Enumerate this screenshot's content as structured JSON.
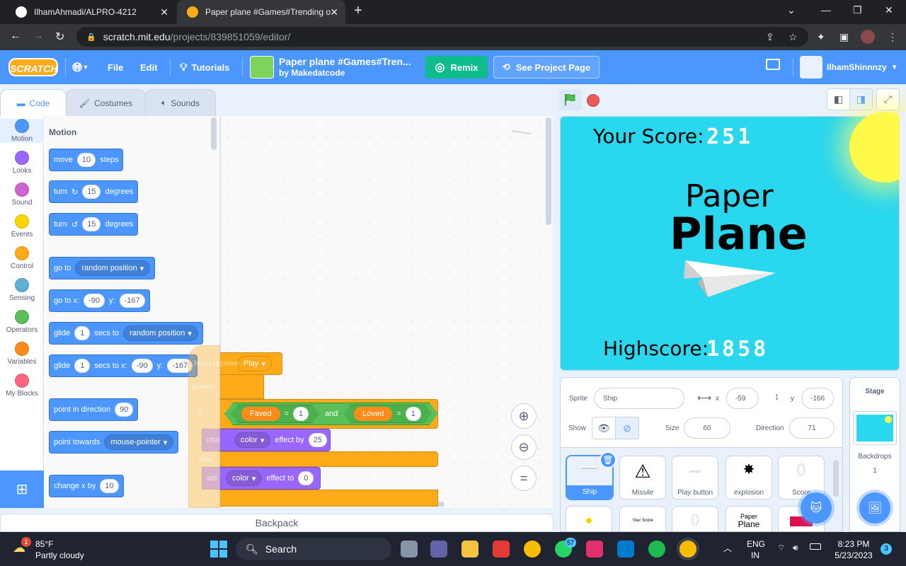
{
  "browser": {
    "tabs": [
      {
        "title": "IlhamAhmadi/ALPRO-4212"
      },
      {
        "title": "Paper plane #Games#Trending o"
      }
    ],
    "url_host": "scratch.mit.edu",
    "url_path": "/projects/839851059/editor/"
  },
  "menubar": {
    "logo": "SCRATCH",
    "file": "File",
    "edit": "Edit",
    "tutorials": "Tutorials",
    "project_title": "Paper plane #Games#Tren...",
    "project_author": "by Makedatcode",
    "remix": "Remix",
    "see_project_page": "See Project Page",
    "username": "IlhamShinnnzy"
  },
  "editor_tabs": {
    "code": "Code",
    "costumes": "Costumes",
    "sounds": "Sounds"
  },
  "categories": [
    {
      "label": "Motion",
      "color": "#4c97ff"
    },
    {
      "label": "Looks",
      "color": "#9966ff"
    },
    {
      "label": "Sound",
      "color": "#cf63cf"
    },
    {
      "label": "Events",
      "color": "#ffd500"
    },
    {
      "label": "Control",
      "color": "#ffab19"
    },
    {
      "label": "Sensing",
      "color": "#5cb1d6"
    },
    {
      "label": "Operators",
      "color": "#59c059"
    },
    {
      "label": "Variables",
      "color": "#ff8c1a"
    },
    {
      "label": "My Blocks",
      "color": "#ff6680"
    }
  ],
  "palette": {
    "heading": "Motion",
    "move": {
      "a": "move",
      "n": "10",
      "b": "steps"
    },
    "turn_right": {
      "a": "turn",
      "n": "15",
      "b": "degrees"
    },
    "turn_left": {
      "a": "turn",
      "n": "15",
      "b": "degrees"
    },
    "goto": {
      "a": "go to",
      "opt": "random position"
    },
    "gotoxy": {
      "a": "go to x:",
      "x": "-90",
      "b": "y:",
      "y": "-167"
    },
    "glide": {
      "a": "glide",
      "n": "1",
      "b": "secs to",
      "opt": "random position"
    },
    "glidexy": {
      "a": "glide",
      "n": "1",
      "b": "secs to x:",
      "x": "-90",
      "c": "y:",
      "y": "-167"
    },
    "point_dir": {
      "a": "point in direction",
      "n": "90"
    },
    "point_towards": {
      "a": "point towards",
      "opt": "mouse-pointer"
    },
    "change_x": {
      "a": "change x by",
      "n": "10"
    }
  },
  "script": {
    "receive": "hen I receive",
    "receive_opt": "Play",
    "forever": "forever",
    "if": "if",
    "faved": "Faved",
    "eq": "=",
    "one": "1",
    "and": "and",
    "loved": "Loved",
    "then": "then",
    "change": "change",
    "color": "color",
    "effect_by": "effect by",
    "n25": "25",
    "else": "else",
    "set": "set",
    "effect_to": "effect to",
    "n0": "0"
  },
  "backpack": "Backpack",
  "stage": {
    "score_label": "Your Score:",
    "score_value": "251",
    "title_top": "Paper",
    "title_bottom": "Plane",
    "highscore_label": "Highscore:",
    "highscore_value": "1858"
  },
  "sprite_info": {
    "sprite_label": "Sprite",
    "sprite_name": "Ship",
    "x_label": "x",
    "x": "-59",
    "y_label": "y",
    "y": "-166",
    "show_label": "Show",
    "size_label": "Size",
    "size": "60",
    "direction_label": "Direction",
    "direction": "71"
  },
  "sprites": [
    "Ship",
    "Missile",
    "Play button",
    "explosion",
    "Score"
  ],
  "sprite_thumb_texts": {
    "score_digit": "0",
    "your_score": "Your Score",
    "zero": "0",
    "paper": "Paper",
    "plane": "Plane"
  },
  "stage_panel": {
    "title": "Stage",
    "backdrops_label": "Backdrops",
    "backdrops_count": "1"
  },
  "taskbar": {
    "weather_temp": "85°F",
    "weather_desc": "Partly cloudy",
    "weather_badge": "1",
    "search": "Search",
    "whatsapp_badge": "57",
    "lang1": "ENG",
    "lang2": "IN",
    "time": "8:23 PM",
    "date": "5/23/2023",
    "notif": "3"
  }
}
